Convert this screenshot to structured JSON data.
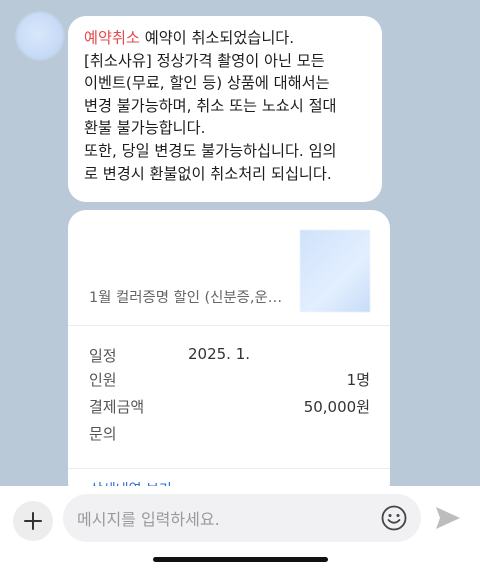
{
  "message": {
    "tag": "예약취소",
    "lines": [
      " 예약이 취소되었습니다.",
      "[취소사유] 정상가격 촬영이 아닌 모든",
      "이벤트(무료, 할인 등) 상품에 대해서는",
      "변경 불가능하며, 취소 또는 노쇼시 절대",
      "환불 불가능합니다.",
      "또한, 당일 변경도 불가능하십니다. 임의",
      "로 변경시 환불없이 취소처리 되십니다."
    ]
  },
  "card": {
    "product_name": "1월 컬러증명 할인 (신분증,운…",
    "details": [
      {
        "label": "일정",
        "value": "2025. 1."
      },
      {
        "label": "인원",
        "value": "1명"
      },
      {
        "label": "결제금액",
        "value": "50,000원"
      },
      {
        "label": "문의",
        "value": ""
      }
    ],
    "footer_link": "상세내역 보기"
  },
  "input": {
    "placeholder": "메시지를 입력하세요."
  },
  "colors": {
    "background": "#b9c9d7",
    "tag": "#e5484d",
    "link": "#2f6bd8"
  },
  "icons": [
    "plus-icon",
    "emoji-icon",
    "send-icon"
  ]
}
